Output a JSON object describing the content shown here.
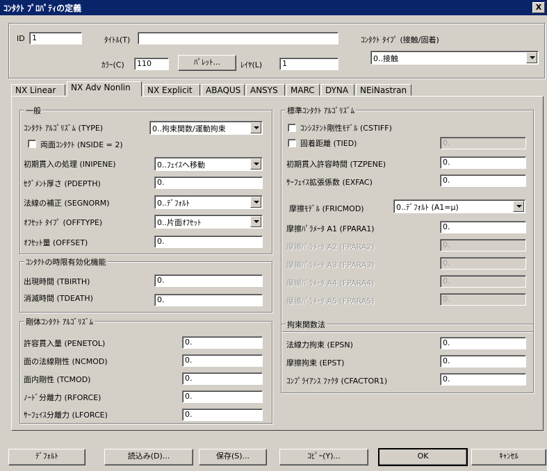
{
  "window": {
    "title": "ｺﾝﾀｸﾄ ﾌﾟﾛﾊﾟﾃｨの定義",
    "close_symbol": "X"
  },
  "top": {
    "id_label": "ID",
    "id_value": "1",
    "title_label": "ﾀｲﾄﾙ(T)",
    "title_value": "",
    "color_label": "ｶﾗｰ(C)",
    "color_value": "110",
    "palette_button": "ﾊﾟﾚｯﾄ...",
    "layer_label": "ﾚｲﾔ(L)",
    "layer_value": "1",
    "contact_type_label": "ｺﾝﾀｸﾄ ﾀｲﾌﾟ (接触/固着)",
    "contact_type_value": "0..接触"
  },
  "tabs": [
    "NX Linear",
    "NX Adv Nonlin",
    "NX Explicit",
    "ABAQUS",
    "ANSYS",
    "MARC",
    "DYNA",
    "NEiNastran"
  ],
  "active_tab": "NX Adv Nonlin",
  "general": {
    "title": "一般",
    "algorithm_label": "ｺﾝﾀｸﾄ ｱﾙｺﾞﾘｽﾞﾑ (TYPE)",
    "algorithm_value": "0..拘束関数/運動拘束",
    "two_sided_label": "両面ｺﾝﾀｸﾄ (NSIDE = 2)",
    "two_sided_checked": false,
    "init_pen_label": "初期貫入の処理 (INIPENE)",
    "init_pen_value": "0..ﾌｪｲｽへ移動",
    "seg_depth_label": "ｾｸﾞﾒﾝﾄ厚さ (PDEPTH)",
    "seg_depth_value": "0.",
    "segnorm_label": "法線の補正 (SEGNORM)",
    "segnorm_value": "0..ﾃﾞﾌｫﾙﾄ",
    "offtype_label": "ｵﾌｾｯﾄ ﾀｲﾌﾟ (OFFTYPE)",
    "offtype_value": "0..片面ｵﾌｾｯﾄ",
    "offset_label": "ｵﾌｾｯﾄ量 (OFFSET)",
    "offset_value": "0."
  },
  "time_limit": {
    "title": "ｺﾝﾀｸﾄの時限有効化機能",
    "birth_label": "出現時間 (TBIRTH)",
    "birth_value": "0.",
    "death_label": "消滅時間 (TDEATH)",
    "death_value": "0."
  },
  "rigid": {
    "title": "剛体ｺﾝﾀｸﾄ ｱﾙｺﾞﾘｽﾞﾑ",
    "penetol_label": "許容貫入量 (PENETOL)",
    "penetol_value": "0.",
    "ncmod_label": "面の法線剛性 (NCMOD)",
    "ncmod_value": "0.",
    "tcmod_label": "面内剛性 (TCMOD)",
    "tcmod_value": "0.",
    "rforce_label": "ﾉｰﾄﾞ分離力 (RFORCE)",
    "rforce_value": "0.",
    "lforce_label": "ｻｰﾌｪｲｽ分離力 (LFORCE)",
    "lforce_value": "0."
  },
  "standard": {
    "title": "標準ｺﾝﾀｸﾄ ｱﾙｺﾞﾘｽﾞﾑ",
    "cstiff_label": "ｺﾝｼｽﾃﾝﾄ剛性ﾓﾃﾞﾙ (CSTIFF)",
    "cstiff_checked": false,
    "tied_label": "固着距離 (TIED)",
    "tied_checked": false,
    "tied_value": "0.",
    "tzpene_label": "初期貫入許容時間 (TZPENE)",
    "tzpene_value": "0.",
    "exfac_label": "ｻｰﾌｪｲｽ拡張係数 (EXFAC)",
    "exfac_value": "0.",
    "fricmod_label": "摩擦ﾓﾃﾞﾙ (FRICMOD)",
    "fricmod_value": "0..ﾃﾞﾌｫﾙﾄ (A1=μ)",
    "fpara1_label": "摩擦ﾊﾟﾗﾒｰﾀ A1 (FPARA1)",
    "fpara1_value": "0.",
    "fpara2_label": "摩擦ﾊﾟﾗﾒｰﾀ A2 (FPARA2)",
    "fpara2_value": "0.",
    "fpara3_label": "摩擦ﾊﾟﾗﾒｰﾀ A3 (FPARA3)",
    "fpara3_value": "0.",
    "fpara4_label": "摩擦ﾊﾟﾗﾒｰﾀ A4 (FPARA4)",
    "fpara4_value": "0.",
    "fpara5_label": "摩擦ﾊﾟﾗﾒｰﾀ A5 (FPARA5)",
    "fpara5_value": "0."
  },
  "constraint": {
    "title": "拘束関数法",
    "epsn_label": "法線力拘束 (EPSN)",
    "epsn_value": "0.",
    "epst_label": "摩擦拘束 (EPST)",
    "epst_value": "0.",
    "cfactor_label": "ｺﾝﾌﾟﾗｲｱﾝｽ ﾌｧｸﾀ (CFACTOR1)",
    "cfactor_value": "0."
  },
  "buttons": {
    "default": "ﾃﾞﾌｫﾙﾄ",
    "load": "読込み(D)...",
    "save": "保存(S)...",
    "copy": "ｺﾋﾟｰ(Y)...",
    "ok": "OK",
    "cancel": "ｷｬﾝｾﾙ"
  }
}
